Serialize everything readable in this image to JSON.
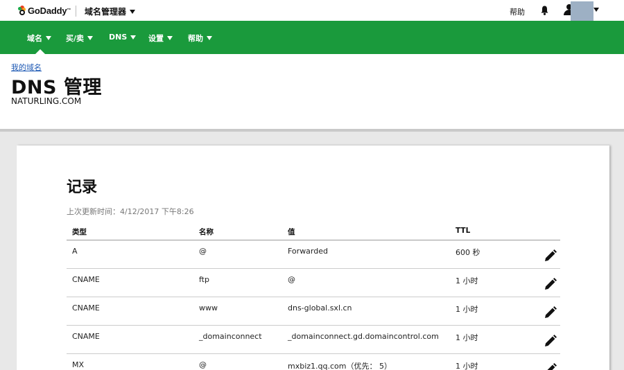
{
  "topbar": {
    "logo_text": "GoDaddy",
    "logo_tm": "™",
    "product_menu": "域名管理器",
    "help": "帮助"
  },
  "nav": {
    "items": [
      {
        "label": "域名"
      },
      {
        "label": "买/卖"
      },
      {
        "label": "DNS"
      },
      {
        "label": "设置"
      },
      {
        "label": "帮助"
      }
    ]
  },
  "header": {
    "breadcrumb": "我的域名",
    "title": "DNS 管理",
    "domain": "NATURLING.COM"
  },
  "records": {
    "title": "记录",
    "updated": "上次更新时间：4/12/2017 下午8:26",
    "columns": {
      "type": "类型",
      "name": "名称",
      "value": "值",
      "ttl": "TTL"
    },
    "rows": [
      {
        "type": "A",
        "name": "@",
        "value": "Forwarded",
        "ttl": "600 秒"
      },
      {
        "type": "CNAME",
        "name": "ftp",
        "value": "@",
        "ttl": "1 小时"
      },
      {
        "type": "CNAME",
        "name": "www",
        "value": "dns-global.sxl.cn",
        "ttl": "1 小时"
      },
      {
        "type": "CNAME",
        "name": "_domainconnect",
        "value": "_domainconnect.gd.domaincontrol.com",
        "ttl": "1 小时"
      },
      {
        "type": "MX",
        "name": "@",
        "value": "mxbiz1.qq.com（优先： 5）",
        "ttl": "1 小时"
      }
    ]
  },
  "colors": {
    "brand_green": "#1a9a3c",
    "link_blue": "#1b57b3",
    "avatar": "#9db0c4"
  }
}
